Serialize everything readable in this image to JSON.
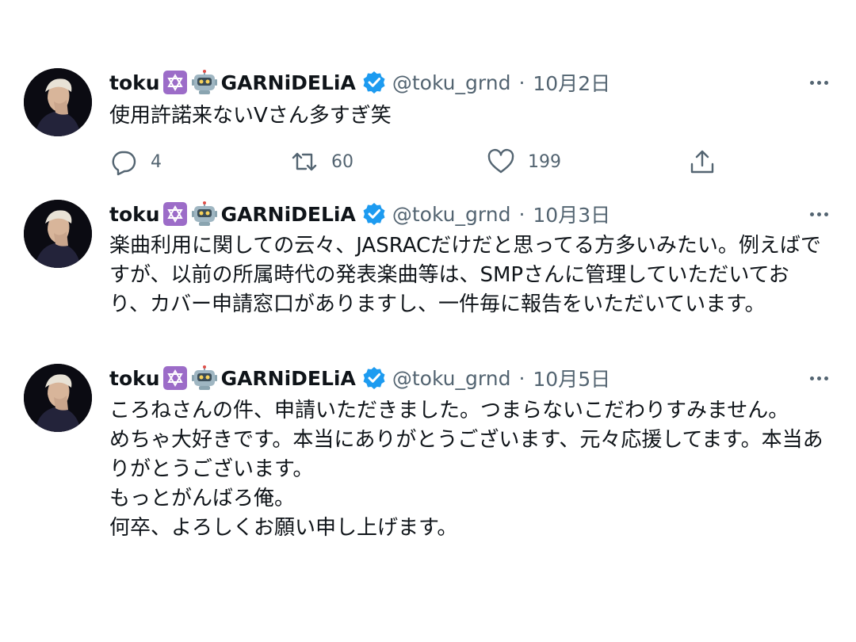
{
  "tweets": [
    {
      "author": {
        "name": "toku",
        "brand": "GARNiDELiA",
        "handle": "@toku_grnd",
        "star_emoji": "star-of-david-icon",
        "robot_emoji": "robot-icon",
        "verified": true
      },
      "separator": "·",
      "date": "10月2日",
      "text": "使用許諾来ないVさん多すぎ笑",
      "stats": {
        "replies": "4",
        "retweets": "60",
        "likes": "199"
      }
    },
    {
      "author": {
        "name": "toku",
        "brand": "GARNiDELiA",
        "handle": "@toku_grnd",
        "star_emoji": "star-of-david-icon",
        "robot_emoji": "robot-icon",
        "verified": true
      },
      "separator": "·",
      "date": "10月3日",
      "text": "楽曲利用に関しての云々、JASRACだけだと思ってる方多いみたい。例えばですが、以前の所属時代の発表楽曲等は、SMPさんに管理していただいており、カバー申請窓口がありますし、一件毎に報告をいただいています。"
    },
    {
      "author": {
        "name": "toku",
        "brand": "GARNiDELiA",
        "handle": "@toku_grnd",
        "star_emoji": "star-of-david-icon",
        "robot_emoji": "robot-icon",
        "verified": true
      },
      "separator": "·",
      "date": "10月5日",
      "text": "ころねさんの件、申請いただきました。つまらないこだわりすみません。\nめちゃ大好きです。本当にありがとうございます、元々応援してます。本当ありがとうございます。\nもっとがんばろ俺。\n何卒、よろしくお願い申し上げます。"
    }
  ],
  "colors": {
    "text": "#0f1419",
    "muted": "#536471",
    "verified": "#1d9bf0",
    "star_bg": "#9c6cc8"
  }
}
